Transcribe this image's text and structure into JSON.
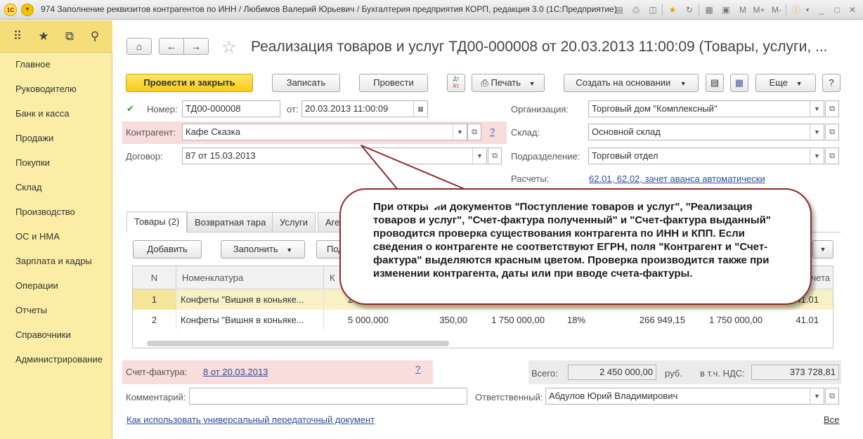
{
  "window": {
    "title": "974 Заполнение реквизитов контрагентов по ИНН / Любимов Валерий Юрьевич / Бухгалтерия предприятия КОРП, редакция 3.0  (1С:Предприятие)",
    "toolbar_m": "M",
    "toolbar_mplus": "M+",
    "toolbar_mminus": "M-"
  },
  "sidebar": {
    "items": [
      {
        "label": "Главное"
      },
      {
        "label": "Руководителю"
      },
      {
        "label": "Банк и касса"
      },
      {
        "label": "Продажи"
      },
      {
        "label": "Покупки"
      },
      {
        "label": "Склад"
      },
      {
        "label": "Производство"
      },
      {
        "label": "ОС и НМА"
      },
      {
        "label": "Зарплата и кадры"
      },
      {
        "label": "Операции"
      },
      {
        "label": "Отчеты"
      },
      {
        "label": "Справочники"
      },
      {
        "label": "Администрирование"
      }
    ]
  },
  "header": {
    "title": "Реализация товаров и услуг ТД00-000008 от 20.03.2013 11:00:09 (Товары, услуги, ..."
  },
  "toolbar": {
    "post_close": "Провести и закрыть",
    "save": "Записать",
    "post": "Провести",
    "dtkt_top": "Дт",
    "dtkt_bottom": "Кт",
    "print": "Печать",
    "create_based": "Создать на основании",
    "more": "Еще",
    "help": "?"
  },
  "form": {
    "number_label": "Номер:",
    "number_value": "ТД00-000008",
    "date_label": "от:",
    "date_value": "20.03.2013 11:00:09",
    "counterparty_label": "Контрагент:",
    "counterparty_value": "Кафе Сказка",
    "counterparty_help": "?",
    "contract_label": "Договор:",
    "contract_value": "87 от 15.03.2013",
    "org_label": "Организация:",
    "org_value": "Торговый дом \"Комплексный\"",
    "warehouse_label": "Склад:",
    "warehouse_value": "Основной склад",
    "division_label": "Подразделение:",
    "division_value": "Торговый отдел",
    "settlements_label": "Расчеты:",
    "settlements_link": "62.01, 62.02, зачет аванса автоматически"
  },
  "tabs": [
    {
      "label": "Товары (2)"
    },
    {
      "label": "Возвратная тара"
    },
    {
      "label": "Услуги"
    },
    {
      "label": "Аге"
    }
  ],
  "table_toolbar": {
    "add": "Добавить",
    "fill": "Заполнить",
    "pick": "Под"
  },
  "table": {
    "headers": {
      "n": "N",
      "item": "Номенклатура",
      "partial_qty": "К",
      "partial_invoice": "чета"
    },
    "rows": [
      {
        "n": "1",
        "item": "Конфеты \"Вишня в коньяке...",
        "qty": "2 00",
        "invoice": "41.01"
      },
      {
        "n": "2",
        "item": "Конфеты \"Вишня в коньяке...",
        "qty": "5 000,000",
        "price": "350,00",
        "sum": "1 750 000,00",
        "vat_rate": "18%",
        "vat": "266 949,15",
        "total": "1 750 000,00",
        "invoice": "41.01"
      }
    ]
  },
  "callout": {
    "text": "При открытии документов \"Поступление товаров и услуг\", \"Реализация товаров и услуг\", \"Счет-фактура полученный\" и \"Счет-фактура выданный\" проводится проверка существования контрагента по ИНН и КПП. Если сведения о контрагенте не соответствуют ЕГРН, поля \"Контрагент и \"Счет-фактура\" выделяются красным цветом. Проверка производится также при изменении контрагента, даты или при вводе счета-фактуры."
  },
  "footer": {
    "invoice_label": "Счет-фактура:",
    "invoice_link": "8 от 20.03.2013",
    "invoice_help": "?",
    "total_label": "Всего:",
    "total_value": "2 450 000,00",
    "currency": "руб.",
    "vat_label": "в т.ч. НДС:",
    "vat_value": "373 728,81",
    "comment_label": "Комментарий:",
    "comment_value": "",
    "responsible_label": "Ответственный:",
    "responsible_value": "Абдулов Юрий Владимирович",
    "udp_link": "Как использовать универсальный передаточный документ",
    "all_link": "Все"
  },
  "colors": {
    "sidebar_bg": "#fbeda5",
    "primary_button": "#f5cb1a",
    "invalid_highlight": "#f9dcdc",
    "callout_border": "#8e2a2a",
    "link": "#2c4d9b"
  }
}
